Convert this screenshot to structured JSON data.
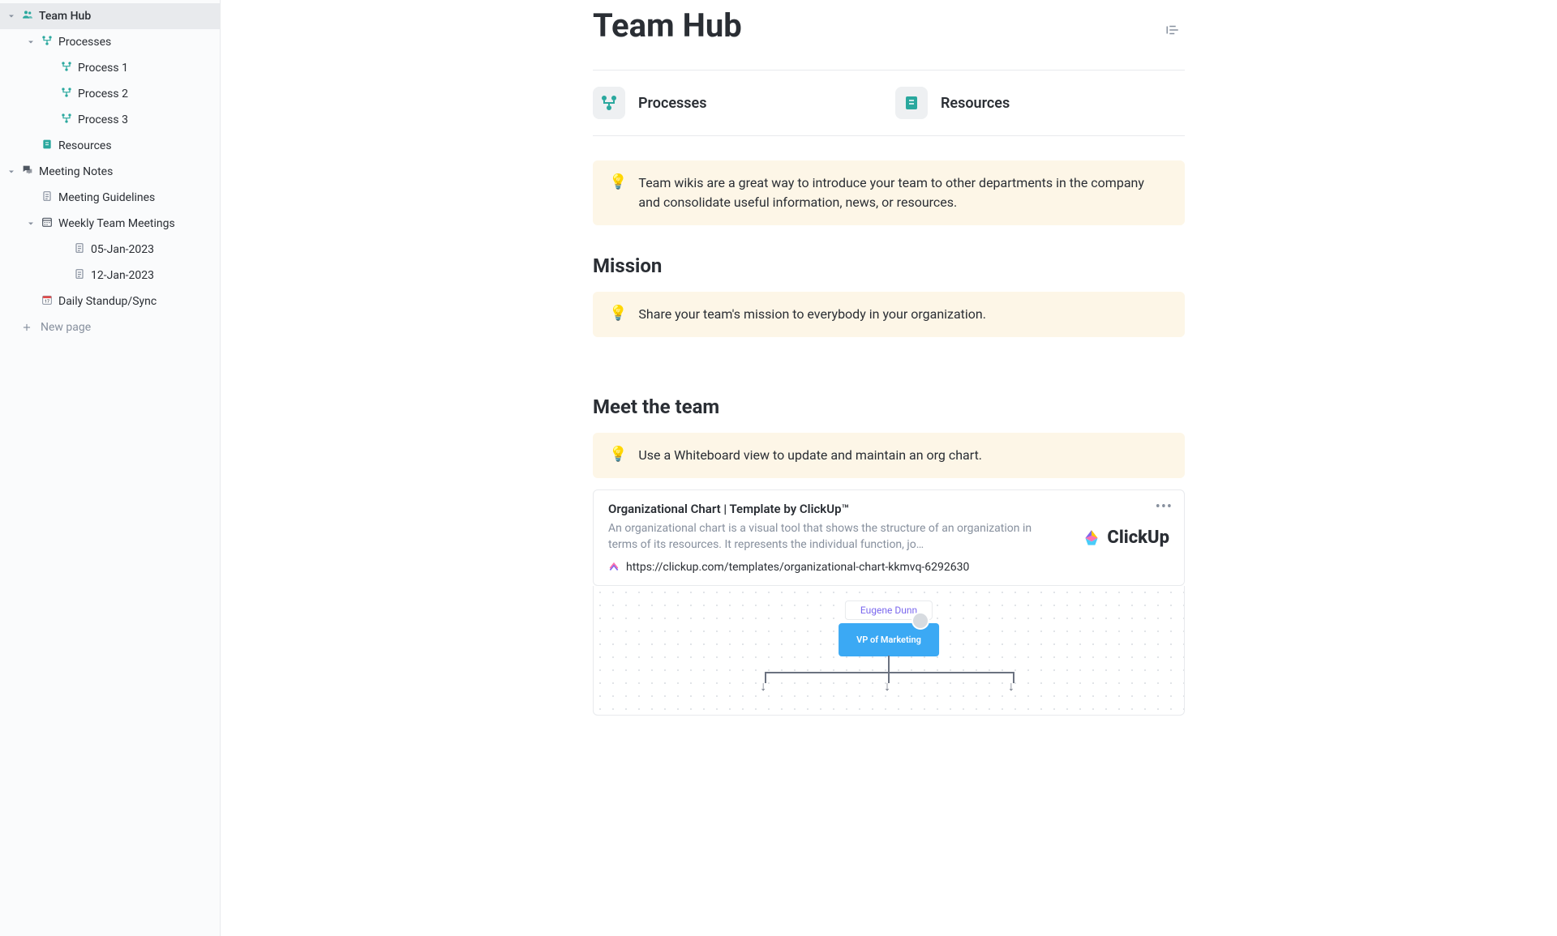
{
  "sidebar": {
    "items": [
      {
        "label": "Team Hub",
        "icon": "people",
        "level": 0,
        "chevron": true,
        "active": true
      },
      {
        "label": "Processes",
        "icon": "workflow",
        "level": 1,
        "chevron": true
      },
      {
        "label": "Process 1",
        "icon": "workflow",
        "level": 2
      },
      {
        "label": "Process 2",
        "icon": "workflow",
        "level": 2
      },
      {
        "label": "Process 3",
        "icon": "workflow",
        "level": 2
      },
      {
        "label": "Resources",
        "icon": "book",
        "level": 1
      },
      {
        "label": "Meeting Notes",
        "icon": "chat",
        "level": 0,
        "chevron": true
      },
      {
        "label": "Meeting Guidelines",
        "icon": "doc",
        "level": 1
      },
      {
        "label": "Weekly Team Meetings",
        "icon": "calendar-grid",
        "level": 1,
        "chevron": true
      },
      {
        "label": "05-Jan-2023",
        "icon": "doc",
        "level": 3
      },
      {
        "label": "12-Jan-2023",
        "icon": "doc",
        "level": 3
      },
      {
        "label": "Daily Standup/Sync",
        "icon": "calendar-day",
        "level": 1
      }
    ],
    "new_page": "New page"
  },
  "page": {
    "title": "Team Hub",
    "cards": [
      {
        "title": "Processes",
        "icon": "workflow"
      },
      {
        "title": "Resources",
        "icon": "book"
      }
    ],
    "callout1": "Team wikis are a great way to introduce your team to other departments in the company and consolidate useful information, news, or resources.",
    "mission_heading": "Mission",
    "callout2": "Share your team's mission to everybody in your organization.",
    "meet_heading": "Meet the team",
    "callout3": "Use a Whiteboard view to update and maintain an org chart.",
    "link_card": {
      "title": "Organizational Chart | Template by ClickUp™",
      "desc": "An organizational chart is a visual tool that shows the structure of an organization in terms of its resources. It represents the individual function, jo…",
      "url": "https://clickup.com/templates/organizational-chart-kkmvq-6292630",
      "brand": "ClickUp"
    },
    "org": {
      "name": "Eugene Dunn",
      "role": "VP of Marketing"
    }
  },
  "icons": {
    "bulb": "💡"
  }
}
